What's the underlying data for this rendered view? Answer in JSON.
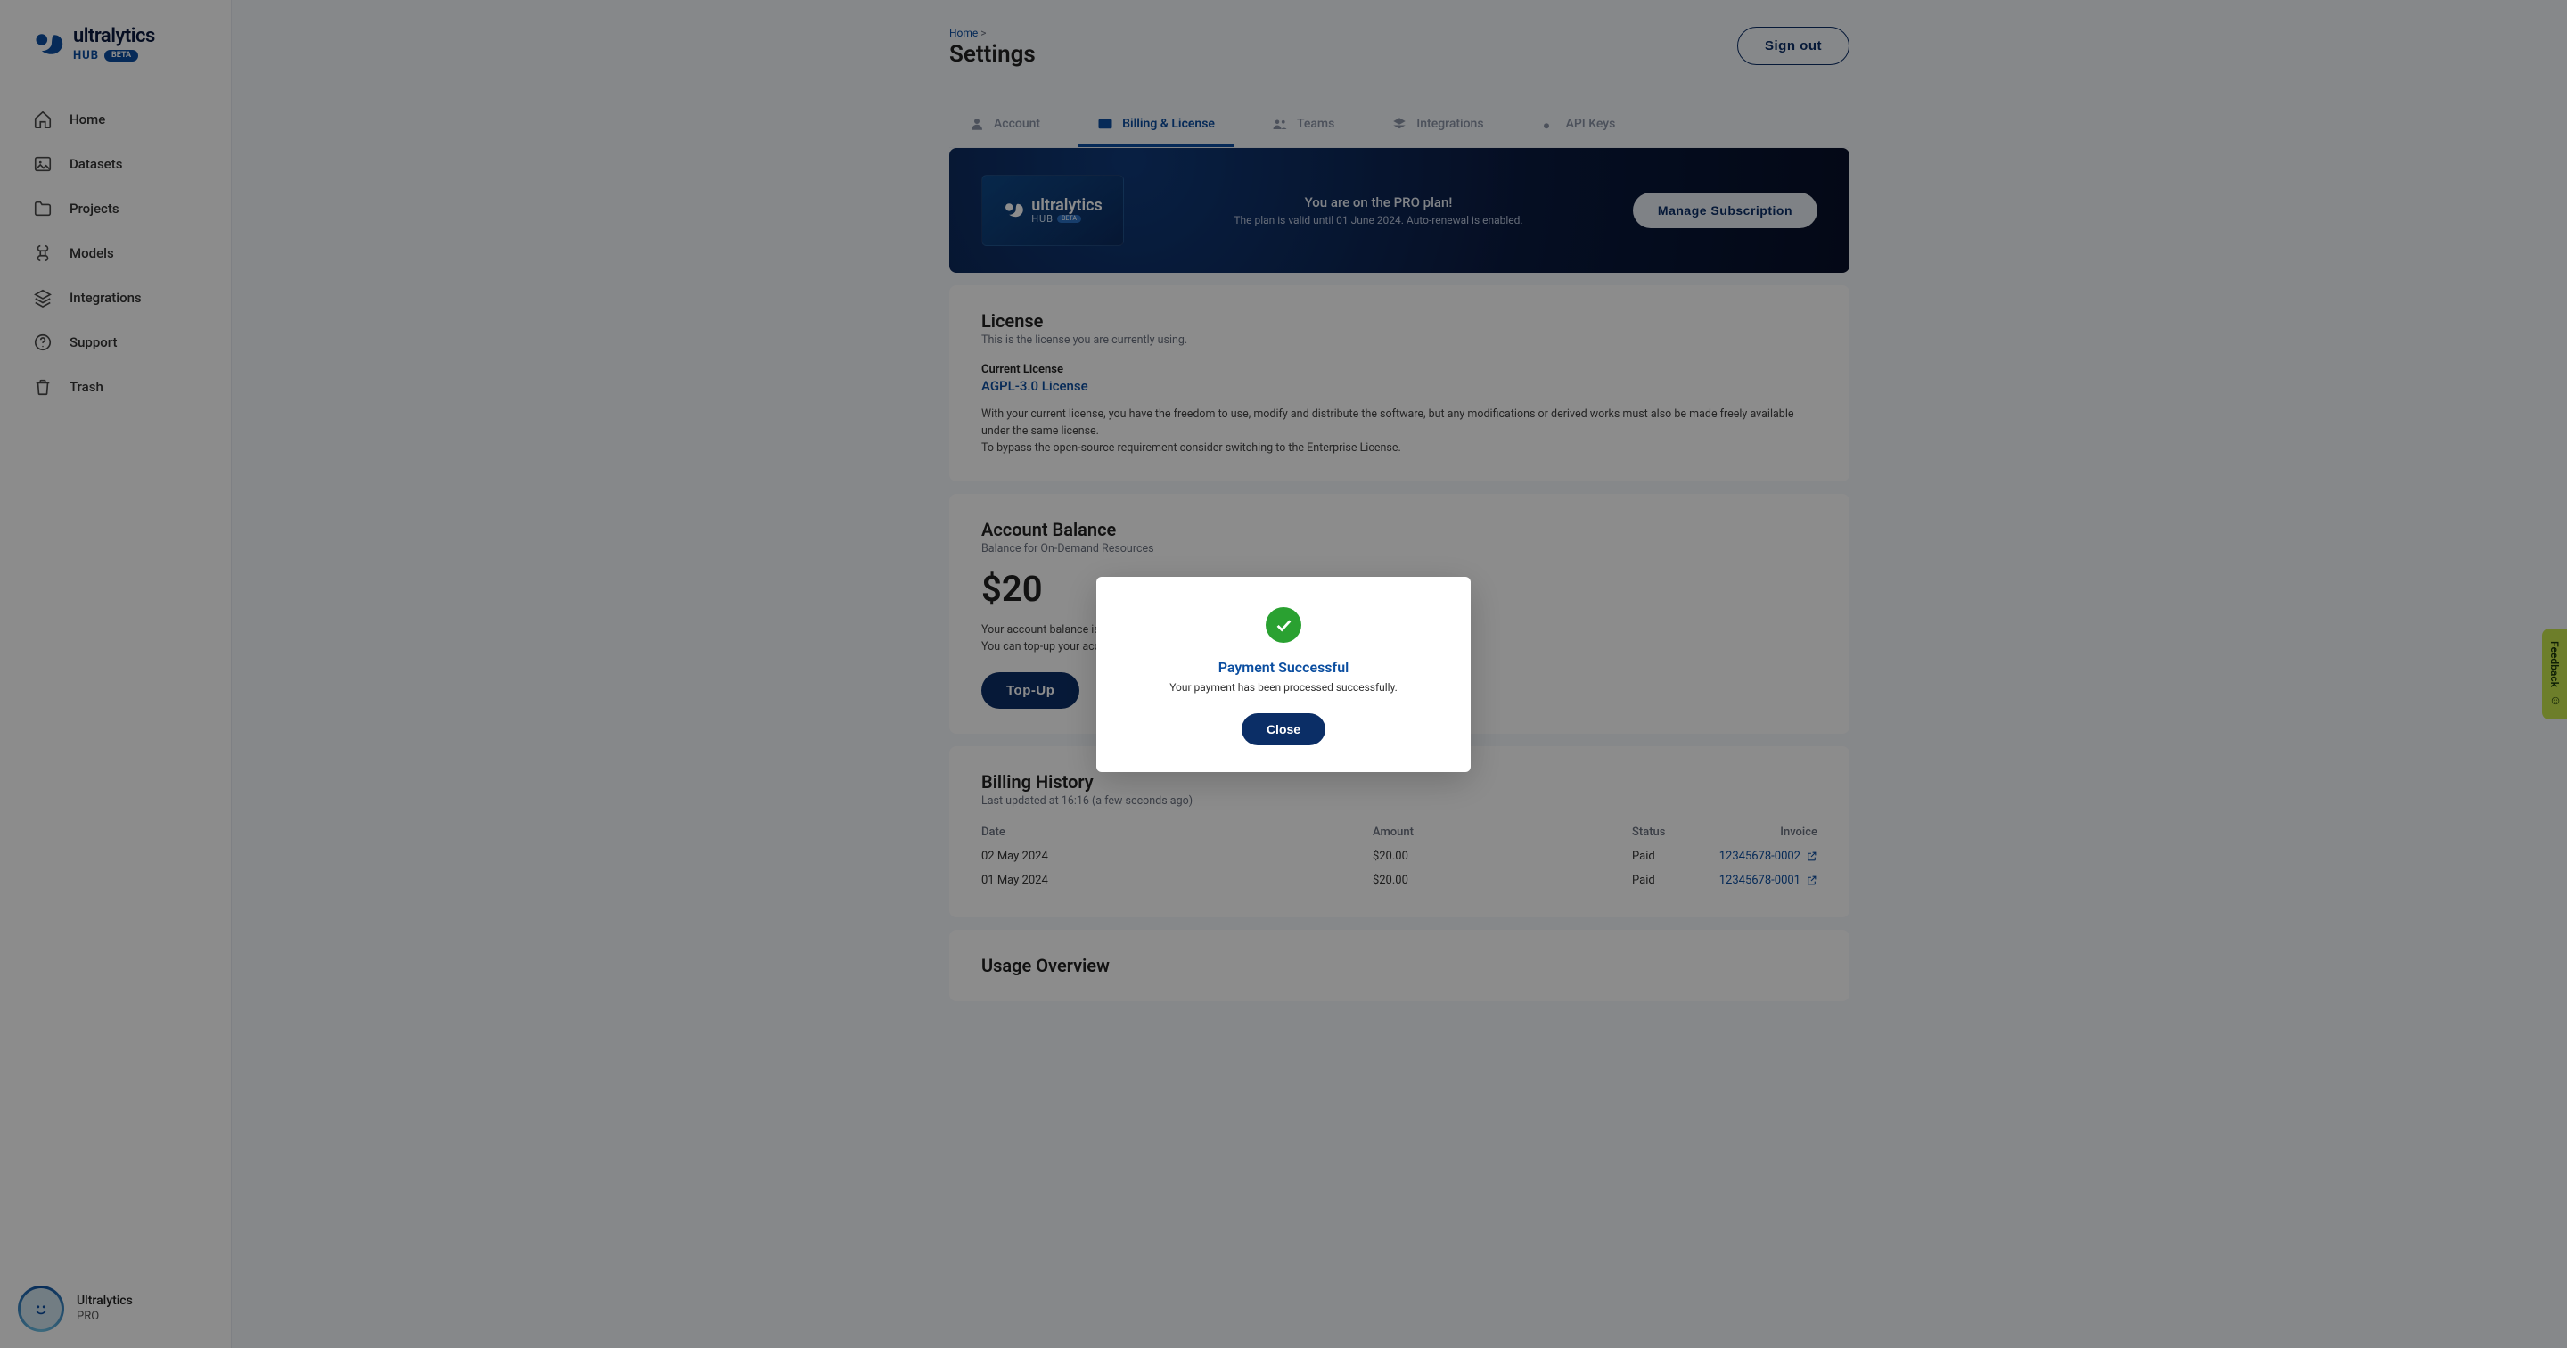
{
  "brand": {
    "name": "ultralytics",
    "hub": "HUB",
    "badge": "BETA"
  },
  "sidebar": {
    "items": [
      {
        "label": "Home"
      },
      {
        "label": "Datasets"
      },
      {
        "label": "Projects"
      },
      {
        "label": "Models"
      },
      {
        "label": "Integrations"
      },
      {
        "label": "Support"
      },
      {
        "label": "Trash"
      }
    ]
  },
  "user": {
    "name": "Ultralytics",
    "plan": "PRO"
  },
  "breadcrumb": {
    "home": "Home",
    "sep": ">"
  },
  "page_title": "Settings",
  "signout": "Sign out",
  "tabs": {
    "account": "Account",
    "billing": "Billing & License",
    "teams": "Teams",
    "integrations": "Integrations",
    "api_keys": "API Keys"
  },
  "plan_banner": {
    "line1": "You are on the PRO plan!",
    "line2": "The plan is valid until 01 June 2024. Auto-renewal is enabled.",
    "manage": "Manage Subscription",
    "logo_label": "ultralytics",
    "logo_hub": "HUB",
    "logo_badge": "BETA"
  },
  "license": {
    "title": "License",
    "subtitle": "This is the license you are currently using.",
    "current_label": "Current License",
    "current_value": "AGPL-3.0 License",
    "body1": "With your current license, you have the freedom to use, modify and distribute the software, but any modifications or derived works must also be made freely available under the same license.",
    "body2": "To bypass the open-source requirement consider switching to the Enterprise License."
  },
  "balance": {
    "title": "Account Balance",
    "subtitle": "Balance for On-Demand Resources",
    "amount": "$20",
    "body1": "Your account balance is used to pay for Ultralytics Cloud Training resources.",
    "body2": "You can top-up your account balance at any time.",
    "topup": "Top-Up"
  },
  "billing": {
    "title": "Billing History",
    "subtitle": "Last updated at 16:16 (a few seconds ago)",
    "cols": {
      "date": "Date",
      "amount": "Amount",
      "status": "Status",
      "invoice": "Invoice"
    },
    "rows": [
      {
        "date": "02 May 2024",
        "amount": "$20.00",
        "status": "Paid",
        "invoice": "12345678-0002"
      },
      {
        "date": "01 May 2024",
        "amount": "$20.00",
        "status": "Paid",
        "invoice": "12345678-0001"
      }
    ]
  },
  "usage": {
    "title": "Usage Overview"
  },
  "feedback": "Feedback",
  "modal": {
    "title": "Payment Successful",
    "body": "Your payment has been processed successfully.",
    "close": "Close"
  }
}
